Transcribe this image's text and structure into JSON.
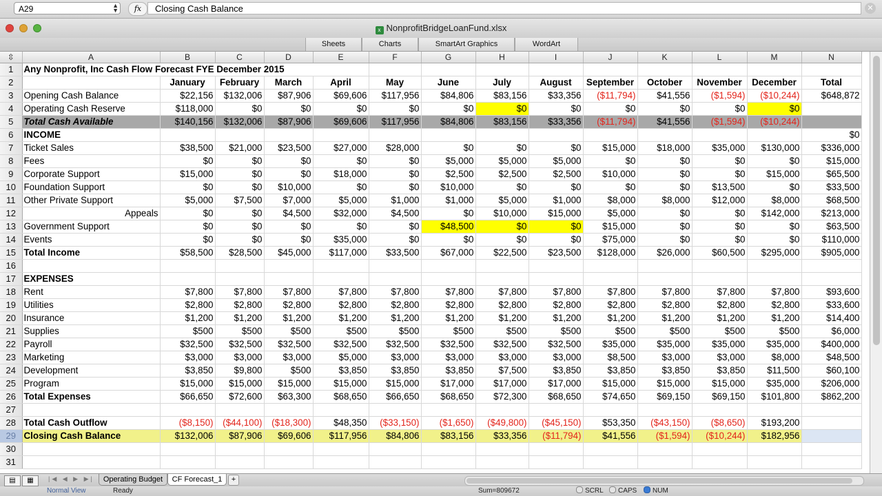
{
  "formula_bar": {
    "name_box": "A29",
    "fx": "fx",
    "formula": "Closing Cash Balance"
  },
  "window": {
    "title": "NonprofitBridgeLoanFund.xlsx"
  },
  "ribbon_tabs": [
    "Sheets",
    "Charts",
    "SmartArt Graphics",
    "WordArt"
  ],
  "column_headers": [
    "A",
    "B",
    "C",
    "D",
    "E",
    "F",
    "G",
    "H",
    "I",
    "J",
    "K",
    "L",
    "M",
    "N"
  ],
  "rows": [
    {
      "n": "1",
      "cells": [
        "Any Nonprofit, Inc Cash Flow Forecast FYE December 2015",
        "",
        "",
        "",
        "",
        "",
        "",
        "",
        "",
        "",
        "",
        "",
        "",
        ""
      ]
    },
    {
      "n": "2",
      "cells": [
        "",
        "January",
        "February",
        "March",
        "April",
        "May",
        "June",
        "July",
        "August",
        "September",
        "October",
        "November",
        "December",
        "Total"
      ]
    },
    {
      "n": "3",
      "cells": [
        "Opening Cash Balance",
        "$22,156",
        "$132,006",
        "$87,906",
        "$69,606",
        "$117,956",
        "$84,806",
        "$83,156",
        "$33,356",
        "($11,794)",
        "$41,556",
        "($1,594)",
        "($10,244)",
        "$648,872"
      ]
    },
    {
      "n": "4",
      "cells": [
        "Operating Cash Reserve",
        "$118,000",
        "$0",
        "$0",
        "$0",
        "$0",
        "$0",
        "$0",
        "$0",
        "$0",
        "$0",
        "$0",
        "$0",
        ""
      ]
    },
    {
      "n": "5",
      "cells": [
        "Total Cash Available",
        "$140,156",
        "$132,006",
        "$87,906",
        "$69,606",
        "$117,956",
        "$84,806",
        "$83,156",
        "$33,356",
        "($11,794)",
        "$41,556",
        "($1,594)",
        "($10,244)",
        ""
      ]
    },
    {
      "n": "6",
      "cells": [
        "INCOME",
        "",
        "",
        "",
        "",
        "",
        "",
        "",
        "",
        "",
        "",
        "",
        "",
        "$0"
      ]
    },
    {
      "n": "7",
      "cells": [
        "Ticket Sales",
        "$38,500",
        "$21,000",
        "$23,500",
        "$27,000",
        "$28,000",
        "$0",
        "$0",
        "$0",
        "$15,000",
        "$18,000",
        "$35,000",
        "$130,000",
        "$336,000"
      ]
    },
    {
      "n": "8",
      "cells": [
        "Fees",
        "$0",
        "$0",
        "$0",
        "$0",
        "$0",
        "$5,000",
        "$5,000",
        "$5,000",
        "$0",
        "$0",
        "$0",
        "$0",
        "$15,000"
      ]
    },
    {
      "n": "9",
      "cells": [
        "Corporate Support",
        "$15,000",
        "$0",
        "$0",
        "$18,000",
        "$0",
        "$2,500",
        "$2,500",
        "$2,500",
        "$10,000",
        "$0",
        "$0",
        "$15,000",
        "$65,500"
      ]
    },
    {
      "n": "10",
      "cells": [
        "Foundation Support",
        "$0",
        "$0",
        "$10,000",
        "$0",
        "$0",
        "$10,000",
        "$0",
        "$0",
        "$0",
        "$0",
        "$13,500",
        "$0",
        "$33,500"
      ]
    },
    {
      "n": "11",
      "cells": [
        "Other Private Support",
        "$5,000",
        "$7,500",
        "$7,000",
        "$5,000",
        "$1,000",
        "$1,000",
        "$5,000",
        "$1,000",
        "$8,000",
        "$8,000",
        "$12,000",
        "$8,000",
        "$68,500"
      ]
    },
    {
      "n": "12",
      "cells": [
        "Appeals",
        "$0",
        "$0",
        "$4,500",
        "$32,000",
        "$4,500",
        "$0",
        "$10,000",
        "$15,000",
        "$5,000",
        "$0",
        "$0",
        "$142,000",
        "$213,000"
      ]
    },
    {
      "n": "13",
      "cells": [
        "Government Support",
        "$0",
        "$0",
        "$0",
        "$0",
        "$0",
        "$48,500",
        "$0",
        "$0",
        "$15,000",
        "$0",
        "$0",
        "$0",
        "$63,500"
      ]
    },
    {
      "n": "14",
      "cells": [
        "Events",
        "$0",
        "$0",
        "$0",
        "$35,000",
        "$0",
        "$0",
        "$0",
        "$0",
        "$75,000",
        "$0",
        "$0",
        "$0",
        "$110,000"
      ]
    },
    {
      "n": "15",
      "cells": [
        "Total Income",
        "$58,500",
        "$28,500",
        "$45,000",
        "$117,000",
        "$33,500",
        "$67,000",
        "$22,500",
        "$23,500",
        "$128,000",
        "$26,000",
        "$60,500",
        "$295,000",
        "$905,000"
      ]
    },
    {
      "n": "16",
      "cells": [
        "",
        "",
        "",
        "",
        "",
        "",
        "",
        "",
        "",
        "",
        "",
        "",
        "",
        ""
      ]
    },
    {
      "n": "17",
      "cells": [
        "EXPENSES",
        "",
        "",
        "",
        "",
        "",
        "",
        "",
        "",
        "",
        "",
        "",
        "",
        ""
      ]
    },
    {
      "n": "18",
      "cells": [
        "Rent",
        "$7,800",
        "$7,800",
        "$7,800",
        "$7,800",
        "$7,800",
        "$7,800",
        "$7,800",
        "$7,800",
        "$7,800",
        "$7,800",
        "$7,800",
        "$7,800",
        "$93,600"
      ]
    },
    {
      "n": "19",
      "cells": [
        "Utilities",
        "$2,800",
        "$2,800",
        "$2,800",
        "$2,800",
        "$2,800",
        "$2,800",
        "$2,800",
        "$2,800",
        "$2,800",
        "$2,800",
        "$2,800",
        "$2,800",
        "$33,600"
      ]
    },
    {
      "n": "20",
      "cells": [
        "Insurance",
        "$1,200",
        "$1,200",
        "$1,200",
        "$1,200",
        "$1,200",
        "$1,200",
        "$1,200",
        "$1,200",
        "$1,200",
        "$1,200",
        "$1,200",
        "$1,200",
        "$14,400"
      ]
    },
    {
      "n": "21",
      "cells": [
        "Supplies",
        "$500",
        "$500",
        "$500",
        "$500",
        "$500",
        "$500",
        "$500",
        "$500",
        "$500",
        "$500",
        "$500",
        "$500",
        "$6,000"
      ]
    },
    {
      "n": "22",
      "cells": [
        "Payroll",
        "$32,500",
        "$32,500",
        "$32,500",
        "$32,500",
        "$32,500",
        "$32,500",
        "$32,500",
        "$32,500",
        "$35,000",
        "$35,000",
        "$35,000",
        "$35,000",
        "$400,000"
      ]
    },
    {
      "n": "23",
      "cells": [
        "Marketing",
        "$3,000",
        "$3,000",
        "$3,000",
        "$5,000",
        "$3,000",
        "$3,000",
        "$3,000",
        "$3,000",
        "$8,500",
        "$3,000",
        "$3,000",
        "$8,000",
        "$48,500"
      ]
    },
    {
      "n": "24",
      "cells": [
        "Development",
        "$3,850",
        "$9,800",
        "$500",
        "$3,850",
        "$3,850",
        "$3,850",
        "$7,500",
        "$3,850",
        "$3,850",
        "$3,850",
        "$3,850",
        "$11,500",
        "$60,100"
      ]
    },
    {
      "n": "25",
      "cells": [
        "Program",
        "$15,000",
        "$15,000",
        "$15,000",
        "$15,000",
        "$15,000",
        "$17,000",
        "$17,000",
        "$17,000",
        "$15,000",
        "$15,000",
        "$15,000",
        "$35,000",
        "$206,000"
      ]
    },
    {
      "n": "26",
      "cells": [
        "Total Expenses",
        "$66,650",
        "$72,600",
        "$63,300",
        "$68,650",
        "$66,650",
        "$68,650",
        "$72,300",
        "$68,650",
        "$74,650",
        "$69,150",
        "$69,150",
        "$101,800",
        "$862,200"
      ]
    },
    {
      "n": "27",
      "cells": [
        "",
        "",
        "",
        "",
        "",
        "",
        "",
        "",
        "",
        "",
        "",
        "",
        "",
        ""
      ]
    },
    {
      "n": "28",
      "cells": [
        "Total Cash Outflow",
        "($8,150)",
        "($44,100)",
        "($18,300)",
        "$48,350",
        "($33,150)",
        "($1,650)",
        "($49,800)",
        "($45,150)",
        "$53,350",
        "($43,150)",
        "($8,650)",
        "$193,200",
        ""
      ]
    },
    {
      "n": "29",
      "cells": [
        "Closing Cash Balance",
        "$132,006",
        "$87,906",
        "$69,606",
        "$117,956",
        "$84,806",
        "$83,156",
        "$33,356",
        "($11,794)",
        "$41,556",
        "($1,594)",
        "($10,244)",
        "$182,956",
        ""
      ]
    },
    {
      "n": "30",
      "cells": [
        "",
        "",
        "",
        "",
        "",
        "",
        "",
        "",
        "",
        "",
        "",
        "",
        "",
        ""
      ]
    },
    {
      "n": "31",
      "cells": [
        "",
        "",
        "",
        "",
        "",
        "",
        "",
        "",
        "",
        "",
        "",
        "",
        "",
        ""
      ]
    }
  ],
  "sheet_tabs": [
    "Operating Budget",
    "CF Forecast_1"
  ],
  "add_tab": "+",
  "status": {
    "view": "Normal View",
    "ready": "Ready",
    "sum": "Sum=809672",
    "indicators": [
      "SCRL",
      "CAPS",
      "NUM"
    ]
  },
  "colors": {
    "highlight_yellow": "#ffff00",
    "negative_red": "#e3251c",
    "total_row_gray": "#a8a8a8"
  }
}
